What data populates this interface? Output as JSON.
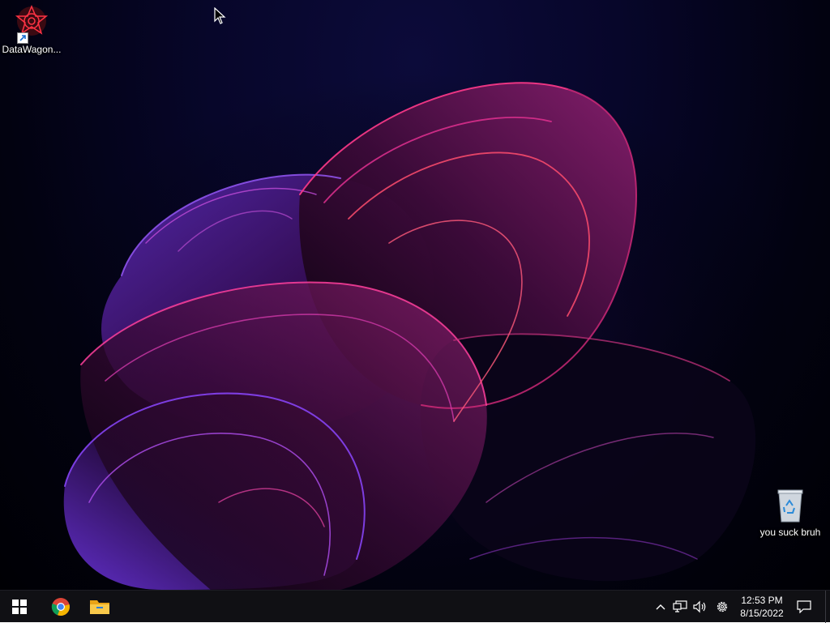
{
  "desktop": {
    "icons": [
      {
        "label": "DataWagon...",
        "icon": "datawagon-icon"
      },
      {
        "label": "you suck bruh",
        "icon": "recycle-bin-icon"
      }
    ]
  },
  "taskbar": {
    "start": {
      "icon": "windows-logo-icon"
    },
    "pinned": [
      {
        "icon": "chrome-icon"
      },
      {
        "icon": "file-explorer-icon"
      }
    ],
    "tray": {
      "icons": [
        "chevron-up-icon",
        "network-icon",
        "volume-icon",
        "settings-gear-icon"
      ],
      "time": "12:53 PM",
      "date": "8/15/2022",
      "notification_icon": "action-center-icon"
    }
  },
  "colors": {
    "taskbar_bg": "#101014",
    "wallpaper_accent_pink": "#e0308f",
    "wallpaper_accent_purple": "#7a3cff"
  }
}
